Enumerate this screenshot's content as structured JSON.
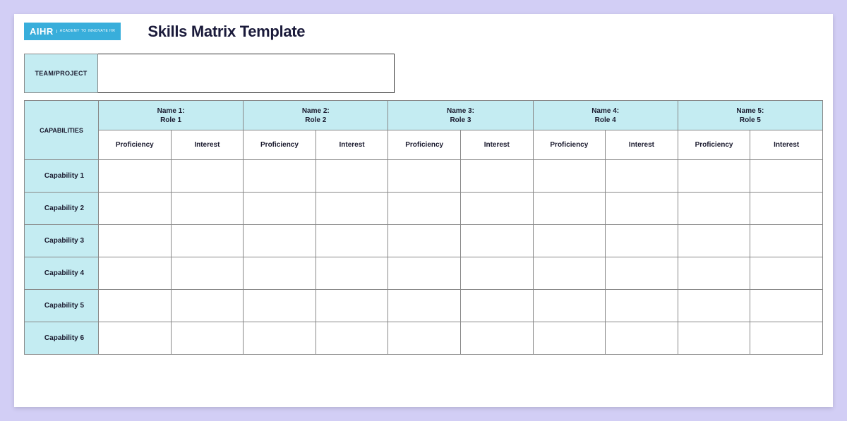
{
  "logo": {
    "main": "AIHR",
    "sub": "ACADEMY TO\nINNOVATE HR"
  },
  "title": "Skills Matrix Template",
  "team_label": "TEAM/PROJECT",
  "team_value": "",
  "capabilities_header": "CAPABILITIES",
  "sub_headers": {
    "proficiency": "Proficiency",
    "interest": "Interest"
  },
  "people": [
    {
      "name": "Name 1:",
      "role": "Role 1"
    },
    {
      "name": "Name 2:",
      "role": "Role 2"
    },
    {
      "name": "Name 3:",
      "role": "Role 3"
    },
    {
      "name": "Name 4:",
      "role": "Role 4"
    },
    {
      "name": "Name 5:",
      "role": "Role 5"
    }
  ],
  "capabilities": [
    "Capability 1",
    "Capability 2",
    "Capability 3",
    "Capability 4",
    "Capability 5",
    "Capability 6"
  ],
  "chart_data": {
    "type": "table",
    "title": "Skills Matrix Template",
    "row_labels": [
      "Capability 1",
      "Capability 2",
      "Capability 3",
      "Capability 4",
      "Capability 5",
      "Capability 6"
    ],
    "column_groups": [
      {
        "name": "Name 1:",
        "role": "Role 1",
        "columns": [
          "Proficiency",
          "Interest"
        ]
      },
      {
        "name": "Name 2:",
        "role": "Role 2",
        "columns": [
          "Proficiency",
          "Interest"
        ]
      },
      {
        "name": "Name 3:",
        "role": "Role 3",
        "columns": [
          "Proficiency",
          "Interest"
        ]
      },
      {
        "name": "Name 4:",
        "role": "Role 4",
        "columns": [
          "Proficiency",
          "Interest"
        ]
      },
      {
        "name": "Name 5:",
        "role": "Role 5",
        "columns": [
          "Proficiency",
          "Interest"
        ]
      }
    ],
    "values": [
      [
        "",
        "",
        "",
        "",
        "",
        "",
        "",
        "",
        "",
        ""
      ],
      [
        "",
        "",
        "",
        "",
        "",
        "",
        "",
        "",
        "",
        ""
      ],
      [
        "",
        "",
        "",
        "",
        "",
        "",
        "",
        "",
        "",
        ""
      ],
      [
        "",
        "",
        "",
        "",
        "",
        "",
        "",
        "",
        "",
        ""
      ],
      [
        "",
        "",
        "",
        "",
        "",
        "",
        "",
        "",
        "",
        ""
      ],
      [
        "",
        "",
        "",
        "",
        "",
        "",
        "",
        "",
        "",
        ""
      ]
    ]
  }
}
